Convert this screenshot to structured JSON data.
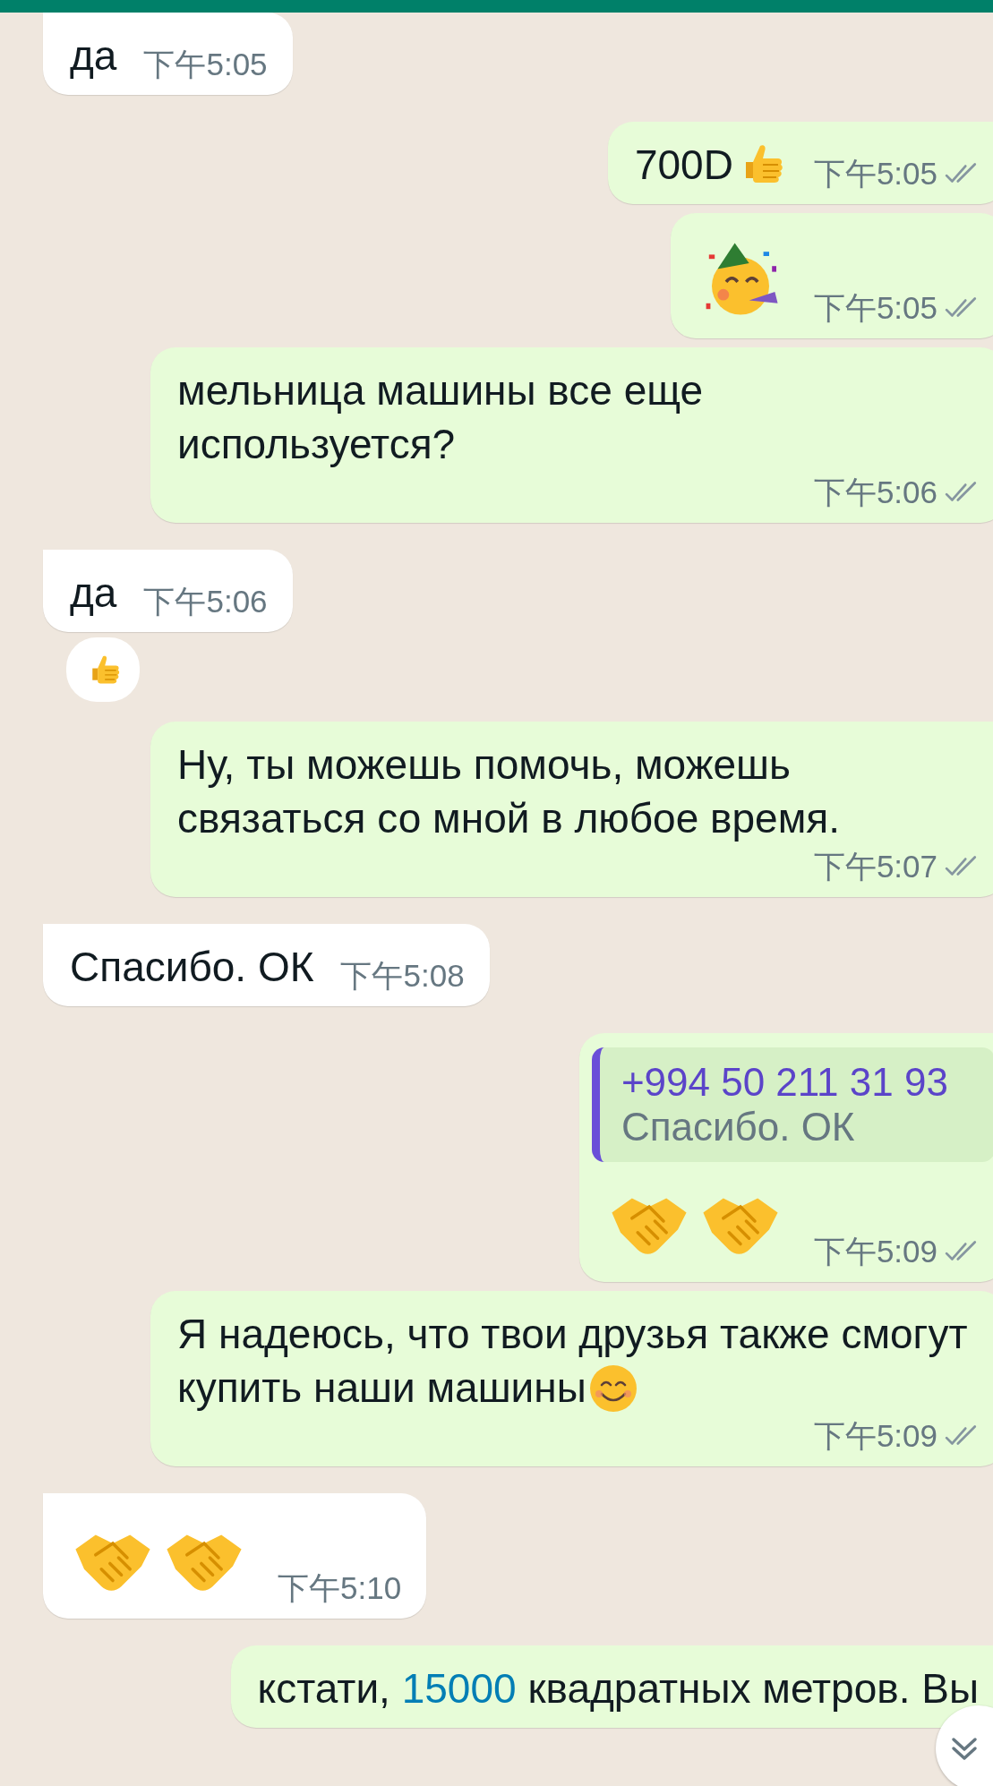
{
  "messages": [
    {
      "outgoing": false,
      "kind": "text",
      "parts": [
        {
          "kind": "text",
          "text": "да"
        }
      ],
      "time": "下午5:05"
    },
    {
      "outgoing": true,
      "kind": "text",
      "parts": [
        {
          "kind": "text",
          "text": "700D"
        },
        {
          "kind": "thumbs-up"
        }
      ],
      "time": "下午5:05",
      "read": false
    },
    {
      "outgoing": true,
      "kind": "emoji",
      "parts": [
        {
          "kind": "party-face"
        }
      ],
      "time": "下午5:05",
      "read": false
    },
    {
      "outgoing": true,
      "kind": "text",
      "parts": [
        {
          "kind": "text",
          "text": "мельница машины все еще используется?"
        }
      ],
      "time": "下午5:06",
      "read": false
    },
    {
      "outgoing": false,
      "kind": "text",
      "parts": [
        {
          "kind": "text",
          "text": "да"
        }
      ],
      "time": "下午5:06",
      "reaction": {
        "kind": "thumbs-up"
      }
    },
    {
      "outgoing": true,
      "kind": "text",
      "parts": [
        {
          "kind": "text",
          "text": "Ну, ты можешь помочь, можешь связаться со мной в любое время."
        }
      ],
      "time": "下午5:07",
      "read": false
    },
    {
      "outgoing": false,
      "kind": "text",
      "parts": [
        {
          "kind": "text",
          "text": "Спасибо. ОК"
        }
      ],
      "time": "下午5:08"
    },
    {
      "outgoing": true,
      "kind": "emoji",
      "quote": {
        "author": "+994 50 211 31 93",
        "text": "Спасибо. ОК"
      },
      "parts": [
        {
          "kind": "handshake"
        },
        {
          "kind": "handshake"
        }
      ],
      "time": "下午5:09",
      "read": false
    },
    {
      "outgoing": true,
      "kind": "text",
      "parts": [
        {
          "kind": "text",
          "text": "Я надеюсь, что твои друзья также смогут купить наши машины"
        },
        {
          "kind": "smile"
        }
      ],
      "time": "下午5:09",
      "read": false
    },
    {
      "outgoing": false,
      "kind": "emoji",
      "parts": [
        {
          "kind": "handshake"
        },
        {
          "kind": "handshake"
        }
      ],
      "time": "下午5:10"
    },
    {
      "outgoing": true,
      "kind": "text",
      "parts": [
        {
          "kind": "text",
          "text": "кстати, "
        },
        {
          "kind": "link",
          "text": "15000"
        },
        {
          "kind": "text",
          "text": " квадратных метров. Вы"
        }
      ]
    }
  ]
}
